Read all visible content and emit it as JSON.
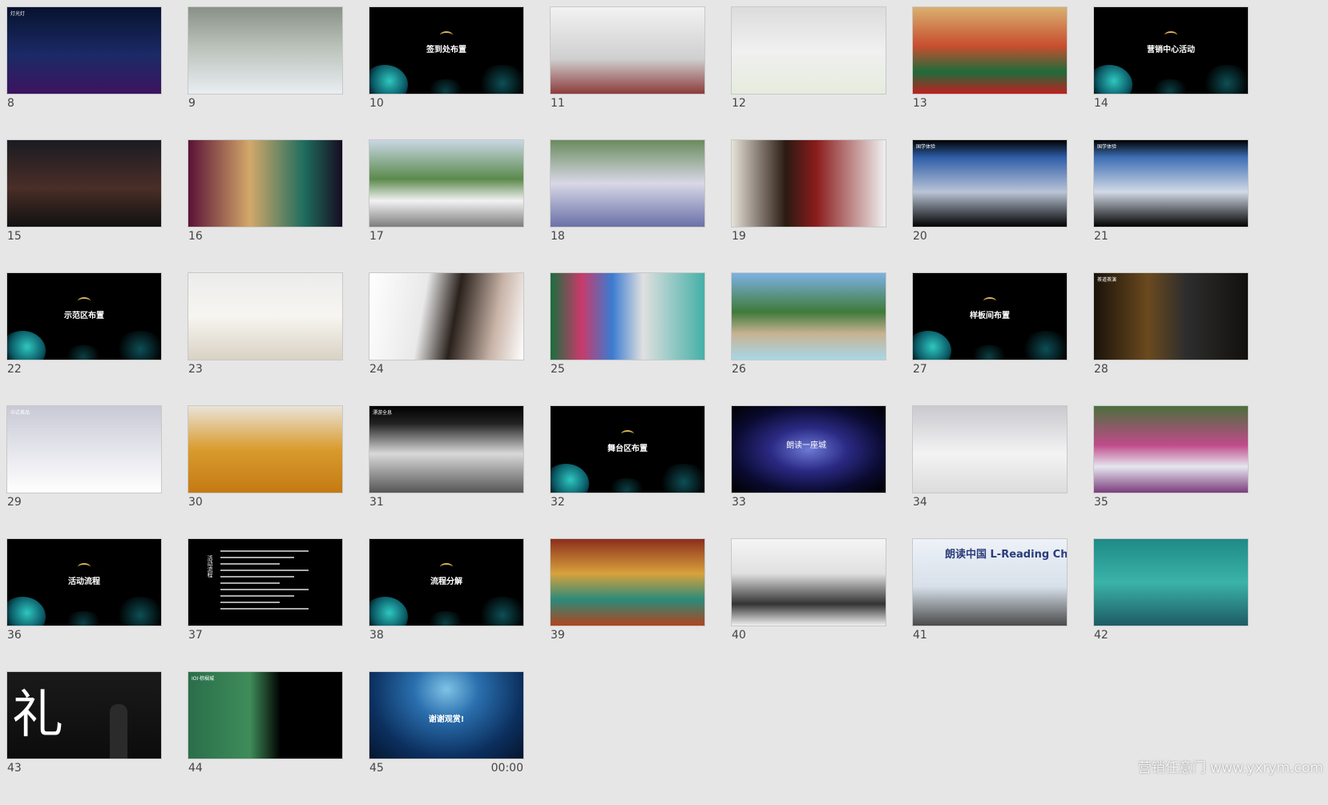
{
  "slides": [
    {
      "number": "8",
      "kind": "photo",
      "bg": "linear-gradient(180deg,#07122e 0%,#1b2a66 55%,#3c1460 100%)",
      "caption": "灯光灯"
    },
    {
      "number": "9",
      "kind": "photo",
      "bg": "linear-gradient(180deg,#8a9088 0%,#b9c1b9 45%,#e9eef2 100%)",
      "caption": ""
    },
    {
      "number": "10",
      "kind": "section",
      "title": "签到处布置"
    },
    {
      "number": "11",
      "kind": "photo",
      "bg": "linear-gradient(180deg,#f2f2f2 0%,#cfcfcf 60%,#8d3b3b 100%)",
      "caption": ""
    },
    {
      "number": "12",
      "kind": "photo",
      "bg": "linear-gradient(180deg,#dcdcdc 0%,#f0f0f0 50%,#e6ecde 100%)",
      "caption": ""
    },
    {
      "number": "13",
      "kind": "photo",
      "bg": "linear-gradient(180deg,#d9b070 0%,#c84e2e 45%,#1e6b3a 75%,#c02020 100%)",
      "caption": ""
    },
    {
      "number": "14",
      "kind": "section",
      "title": "营销中心活动"
    },
    {
      "number": "15",
      "kind": "photo",
      "bg": "linear-gradient(180deg,#1b1b22 0%,#4a2e27 55%,#111 100%)",
      "caption": ""
    },
    {
      "number": "16",
      "kind": "photo",
      "bg": "linear-gradient(90deg,#5a1236 0%,#d3a86a 40%,#1f6d5e 75%,#160c20 100%)",
      "caption": ""
    },
    {
      "number": "17",
      "kind": "photo",
      "bg": "linear-gradient(180deg,#c8d7e4 0%,#5b8a4c 45%,#f2f2f2 70%,#7d7d7d 100%)",
      "caption": ""
    },
    {
      "number": "18",
      "kind": "photo",
      "bg": "linear-gradient(180deg,#6b8b5e 0%,#d8d8e6 50%,#6b70a8 100%)",
      "caption": ""
    },
    {
      "number": "19",
      "kind": "photo",
      "bg": "linear-gradient(90deg,#e6e2d8 0%,#2a1a12 35%,#8a1c1c 55%,#f0f0f0 100%)",
      "caption": ""
    },
    {
      "number": "20",
      "kind": "photo",
      "bg": "linear-gradient(180deg,#000 0%,#2f5ea8 20%,#b9c4d6 60%,#000 100%)",
      "caption": "国学体验"
    },
    {
      "number": "21",
      "kind": "photo",
      "bg": "linear-gradient(180deg,#000 0%,#3e6fb4 20%,#d2dae6 60%,#000 100%)",
      "caption": "国学体验"
    },
    {
      "number": "22",
      "kind": "section",
      "title": "示范区布置"
    },
    {
      "number": "23",
      "kind": "photo",
      "bg": "linear-gradient(180deg,#ececec 0%,#f7f5f0 50%,#d9d2c4 100%)",
      "caption": ""
    },
    {
      "number": "24",
      "kind": "photo",
      "bg": "linear-gradient(100deg,#ffffff 0%,#e9e9e9 35%,#2a211c 55%,#c9b4a8 80%,#ffffff 100%)",
      "caption": ""
    },
    {
      "number": "25",
      "kind": "photo",
      "bg": "linear-gradient(90deg,#1b6e3e 0%,#c93a6b 20%,#3b7bd1 40%,#e0e0e0 60%,#44b0a8 100%)",
      "caption": ""
    },
    {
      "number": "26",
      "kind": "photo",
      "bg": "linear-gradient(180deg,#7db2e4 0%,#3f7a3a 45%,#c8b292 70%,#a7d7e8 100%)",
      "caption": ""
    },
    {
      "number": "27",
      "kind": "section",
      "title": "样板间布置"
    },
    {
      "number": "28",
      "kind": "photo",
      "bg": "linear-gradient(90deg,#1a120a 0%,#6b4a1e 35%,#2d2d2d 60%,#12100e 100%)",
      "caption": "茶道茶演"
    },
    {
      "number": "29",
      "kind": "photo",
      "bg": "linear-gradient(180deg,#c9c9d6 0%,#e7e7ee 55%,#ffffff 100%)",
      "caption": "中式茶品"
    },
    {
      "number": "30",
      "kind": "photo",
      "bg": "linear-gradient(180deg,#e9e4d8 0%,#d99b2e 50%,#c47a12 100%)",
      "caption": ""
    },
    {
      "number": "31",
      "kind": "photo",
      "bg": "linear-gradient(180deg,#000 0%,#222 20%,#d9d9d9 55%,#555 100%)",
      "caption": "漂游全息"
    },
    {
      "number": "32",
      "kind": "section",
      "title": "舞台区布置"
    },
    {
      "number": "33",
      "kind": "photo",
      "bg": "radial-gradient(ellipse at center,#6d7bd6 0%,#2b2a84 35%,#0a0a30 70%,#000 100%)",
      "caption": "朗读一座城"
    },
    {
      "number": "34",
      "kind": "photo",
      "bg": "linear-gradient(180deg,#c9c9cf 0%,#f3f3f3 55%,#dcdcdc 100%)",
      "caption": ""
    },
    {
      "number": "35",
      "kind": "photo",
      "bg": "linear-gradient(180deg,#4b6f3c 0%,#c04b8a 45%,#e6e6f0 70%,#7a3d7c 100%)",
      "caption": ""
    },
    {
      "number": "36",
      "kind": "section",
      "title": "活动流程"
    },
    {
      "number": "37",
      "kind": "text",
      "caption": "活动流程"
    },
    {
      "number": "38",
      "kind": "section",
      "title": "流程分解"
    },
    {
      "number": "39",
      "kind": "photo",
      "bg": "linear-gradient(180deg,#8c2e1c 0%,#d8a23c 40%,#2b8a7a 70%,#b0441f 100%)",
      "caption": ""
    },
    {
      "number": "40",
      "kind": "photo",
      "bg": "linear-gradient(180deg,#f5f5f5 0%,#e0e0e0 40%,#333 75%,#f1f1f1 100%)",
      "caption": ""
    },
    {
      "number": "41",
      "kind": "photo",
      "bg": "linear-gradient(180deg,#eef2f8 0%,#d7e0ea 55%,#4a4a4a 100%)",
      "caption": "朗读中国 L-Reading China"
    },
    {
      "number": "42",
      "kind": "photo",
      "bg": "linear-gradient(180deg,#1e8a86 0%,#3bb3a8 50%,#1d5b64 100%)",
      "caption": ""
    },
    {
      "number": "43",
      "kind": "photo",
      "bg": "linear-gradient(180deg,#1a1a1a 0%,#0c0c0c 100%)",
      "caption": "礼"
    },
    {
      "number": "44",
      "kind": "photo",
      "bg": "linear-gradient(90deg,#2a6e4a 0%,#3f8c5a 40%,#000 60%,#000 100%)",
      "caption": "IOI·棕榈城"
    },
    {
      "number": "45",
      "kind": "water",
      "title": "谢谢观赏!",
      "time": "00:00"
    }
  ],
  "watermark": "营销任意门 www.yxrym.com"
}
